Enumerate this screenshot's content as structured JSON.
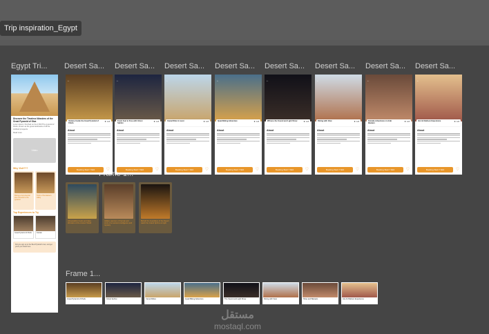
{
  "board_title": "Trip inspiration_Egypt",
  "frame_labels": {
    "main": "Egypt Tri...",
    "desert_1": "Desert Sa...",
    "desert_2": "Desert Sa...",
    "desert_3": "Desert Sa...",
    "desert_4": "Desert Sa...",
    "desert_5": "Desert Sa...",
    "desert_6": "Desert Sa...",
    "desert_7": "Desert Sa...",
    "desert_8": "Desert Sa...",
    "frame_small": "Frame 1...",
    "frame_row": "Frame 1..."
  },
  "main_phone": {
    "heading": "Discover the Timeless Wonders of the Great Pyramid of Giza",
    "body": "Lorem Ipsum: Perched on the 4,500 The pyramid of Khufu, known as the great landmarks of all the civilized prospects",
    "more": "Read more",
    "gray_button": "Video",
    "section_1": "Why Visit???",
    "card_1": "Rising a monumental site connects to the pyramid",
    "card_2": "Tomb of the Eastern valley",
    "section_2": "Top Experiences to Try",
    "tile_1": "Great Pyramid of Khufu",
    "tile_2": "Karnak",
    "bubble": "Did you sign up to the Best Pyramid's tour, and get yours you travel here"
  },
  "cards": [
    {
      "name": "Venture Inside the Great Pyramid of Khufu",
      "rating": "★ 4.8",
      "about": "About",
      "book": "Booking Start 7 $10",
      "colors": [
        "#5a3e22",
        "#c79a4a"
      ]
    },
    {
      "name": "Fresh Feel to Free with Ghost Sphinx",
      "rating": "★ 4.8",
      "about": "About",
      "book": "Booking Start 7 $10",
      "colors": [
        "#1d2540",
        "#6a5a48"
      ]
    },
    {
      "name": "Camel Ride in Luxor",
      "rating": "★ 4.8",
      "about": "About",
      "book": "Booking Start 7 $10",
      "colors": [
        "#bcd6ea",
        "#c9a46a"
      ]
    },
    {
      "name": "Quad Biking Adventure",
      "rating": "★ 4.8",
      "about": "About",
      "book": "Booking Start 7 $10",
      "colors": [
        "#4a6f8a",
        "#d9a24a"
      ]
    },
    {
      "name": "Witness the Sound and Light Show",
      "rating": "★ 4.8",
      "about": "About",
      "book": "Booking Start 7 $10",
      "colors": [
        "#101018",
        "#3b2e28"
      ]
    },
    {
      "name": "Dining with View",
      "rating": "★ 4.8",
      "about": "About",
      "book": "Booking Start 7 $10",
      "colors": [
        "#cfdbe6",
        "#b0704a"
      ]
    },
    {
      "name": "Outside Adventures in Arab Bazaars",
      "rating": "★ 4.8",
      "about": "About",
      "book": "Booking Start 7 $10",
      "colors": [
        "#6a4a3a",
        "#c08a6a"
      ]
    },
    {
      "name": "Hot Air Balloon Experience",
      "rating": "★ 4.8",
      "about": "About",
      "book": "Booking Start 7 $10",
      "colors": [
        "#e4c08e",
        "#a0584a"
      ]
    }
  ],
  "small_frames": [
    {
      "text": "Abracadabra books and tales Wonders of the Ancient World",
      "colors": [
        "#2e4a5e",
        "#c9a24a"
      ]
    },
    {
      "text": "Hidden sanctum of Karnak and tomb of an ancient intelligence and mystery",
      "colors": [
        "#5a3e2a",
        "#b98a5a"
      ]
    },
    {
      "text": "Behold the Guardians of the Desert watch the Grand Sphinx at night",
      "colors": [
        "#1a1410",
        "#c07a2a"
      ]
    }
  ],
  "thumbs": [
    {
      "label": "Great Pyramid of Khufu",
      "colors": [
        "#5a3e22",
        "#c79a4a"
      ]
    },
    {
      "label": "Ghost Sphinx",
      "colors": [
        "#1d2540",
        "#6a5a48"
      ]
    },
    {
      "label": "Camel Rides",
      "colors": [
        "#bcd6ea",
        "#c9a46a"
      ]
    },
    {
      "label": "Quad Biking Adventure",
      "colors": [
        "#4a6f8a",
        "#d9a24a"
      ]
    },
    {
      "label": "The Sound and Light Show",
      "colors": [
        "#101018",
        "#3b2e28"
      ]
    },
    {
      "label": "Dining with View",
      "colors": [
        "#cfdbe6",
        "#b0704a"
      ]
    },
    {
      "label": "Shop and Bazaars",
      "colors": [
        "#6a4a3a",
        "#c08a6a"
      ]
    },
    {
      "label": "Hot Air Balloon Experience",
      "colors": [
        "#e4c08e",
        "#a0584a"
      ]
    }
  ],
  "watermark": {
    "top": "مستقل",
    "bottom": "mostaql.com"
  }
}
